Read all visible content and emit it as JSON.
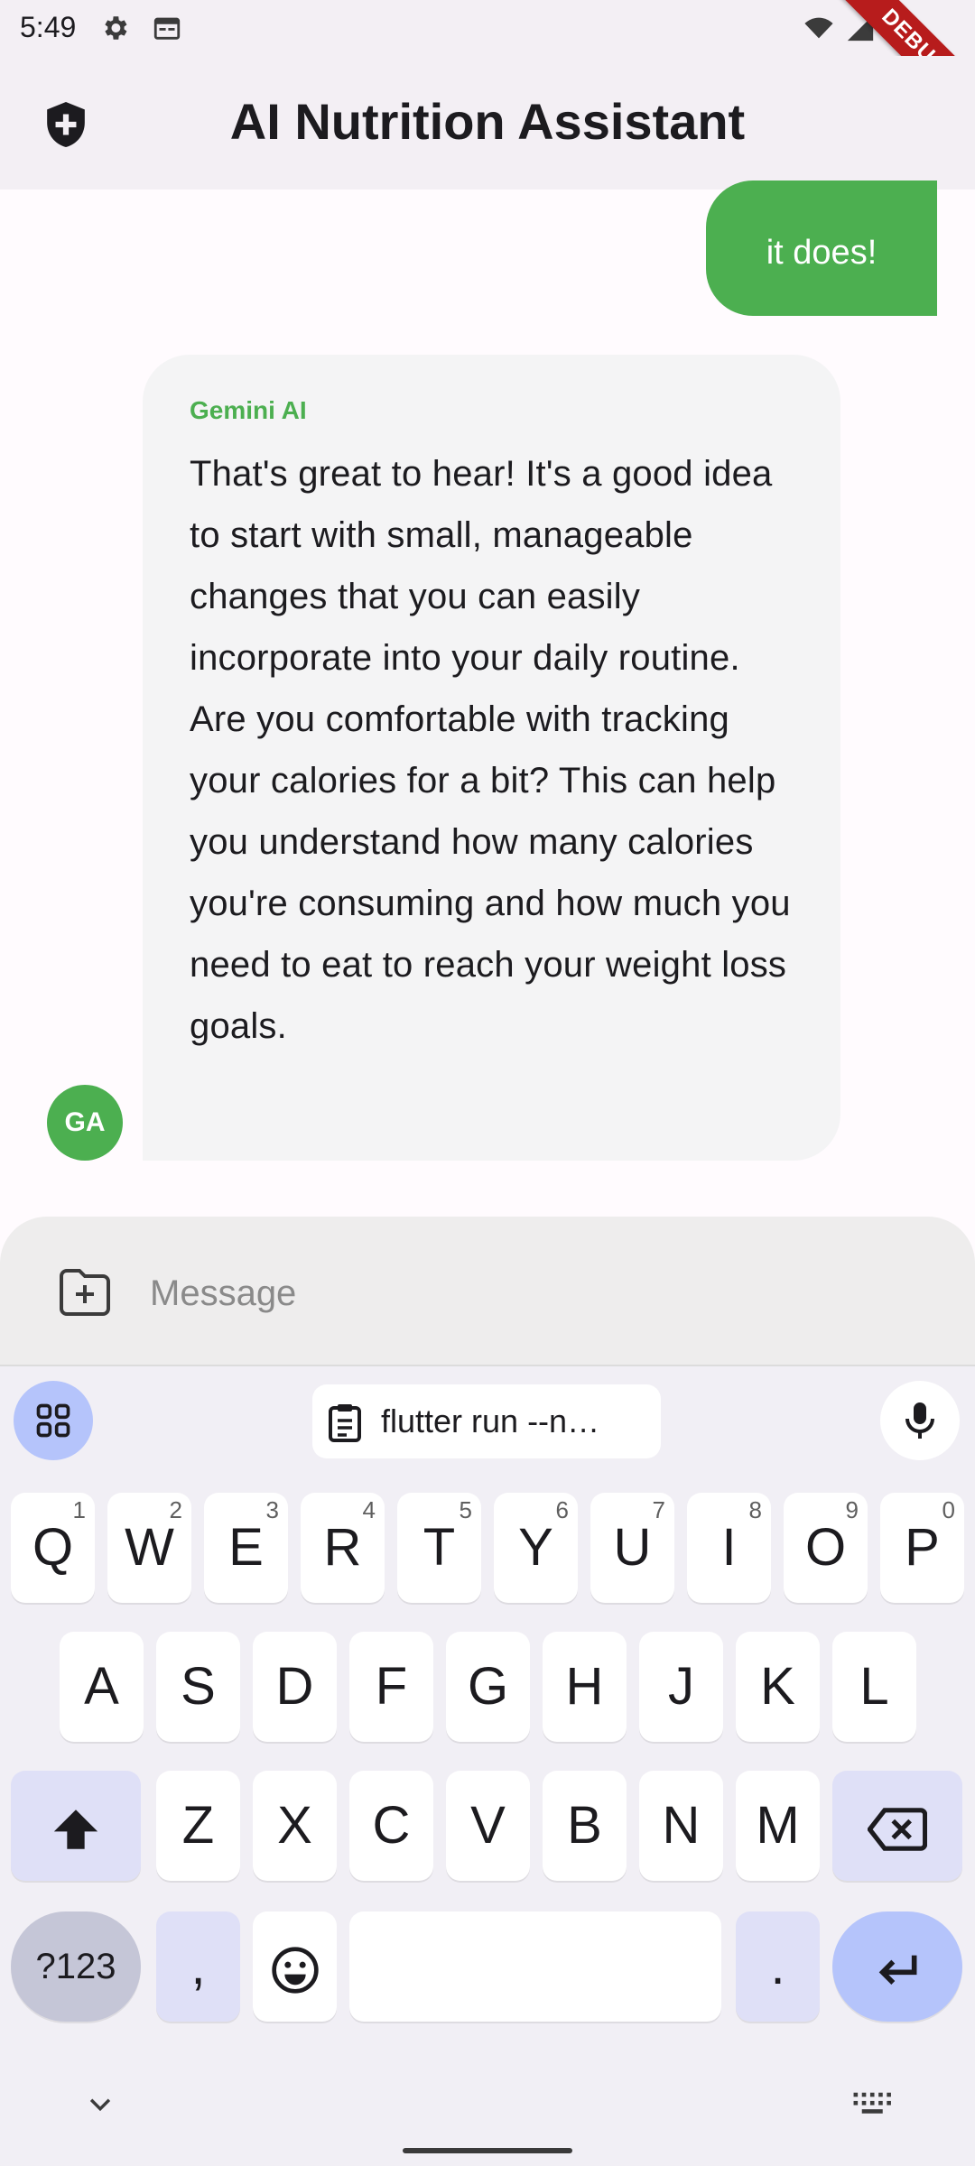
{
  "status_bar": {
    "time": "5:49",
    "icons": [
      "gear-icon",
      "calendar-icon",
      "wifi-icon",
      "signal-icon",
      "battery-icon"
    ],
    "debug_banner": "DEBUG"
  },
  "app_bar": {
    "title": "AI Nutrition Assistant",
    "leading_icon": "shield-plus-icon"
  },
  "chat": {
    "messages": [
      {
        "role": "user",
        "text": "it does!"
      },
      {
        "role": "ai",
        "sender": "Gemini AI",
        "avatar": "GA",
        "text": "That's great to hear! It's a good idea to start with small, manageable changes that you can easily incorporate into your daily routine.  Are you comfortable with tracking your calories for a bit? This can help you understand how many calories you're consuming and how much you need to eat to reach your weight loss goals."
      }
    ]
  },
  "input": {
    "placeholder": "Message",
    "value": "",
    "attach_icon": "folder-plus-icon"
  },
  "keyboard": {
    "clipboard_suggestion": "flutter run --n…",
    "row1": [
      {
        "key": "Q",
        "hint": "1"
      },
      {
        "key": "W",
        "hint": "2"
      },
      {
        "key": "E",
        "hint": "3"
      },
      {
        "key": "R",
        "hint": "4"
      },
      {
        "key": "T",
        "hint": "5"
      },
      {
        "key": "Y",
        "hint": "6"
      },
      {
        "key": "U",
        "hint": "7"
      },
      {
        "key": "I",
        "hint": "8"
      },
      {
        "key": "O",
        "hint": "9"
      },
      {
        "key": "P",
        "hint": "0"
      }
    ],
    "row2": [
      "A",
      "S",
      "D",
      "F",
      "G",
      "H",
      "J",
      "K",
      "L"
    ],
    "row3": [
      "Z",
      "X",
      "C",
      "V",
      "B",
      "N",
      "M"
    ],
    "symbols_label": "?123",
    "comma": ",",
    "period": ".",
    "colors": {
      "accent": "#b5c4fb",
      "function_key": "#dfe0f7",
      "key": "#ffffff"
    }
  },
  "colors": {
    "brand_green": "#4caf50",
    "debug_red": "#b71c1c"
  }
}
